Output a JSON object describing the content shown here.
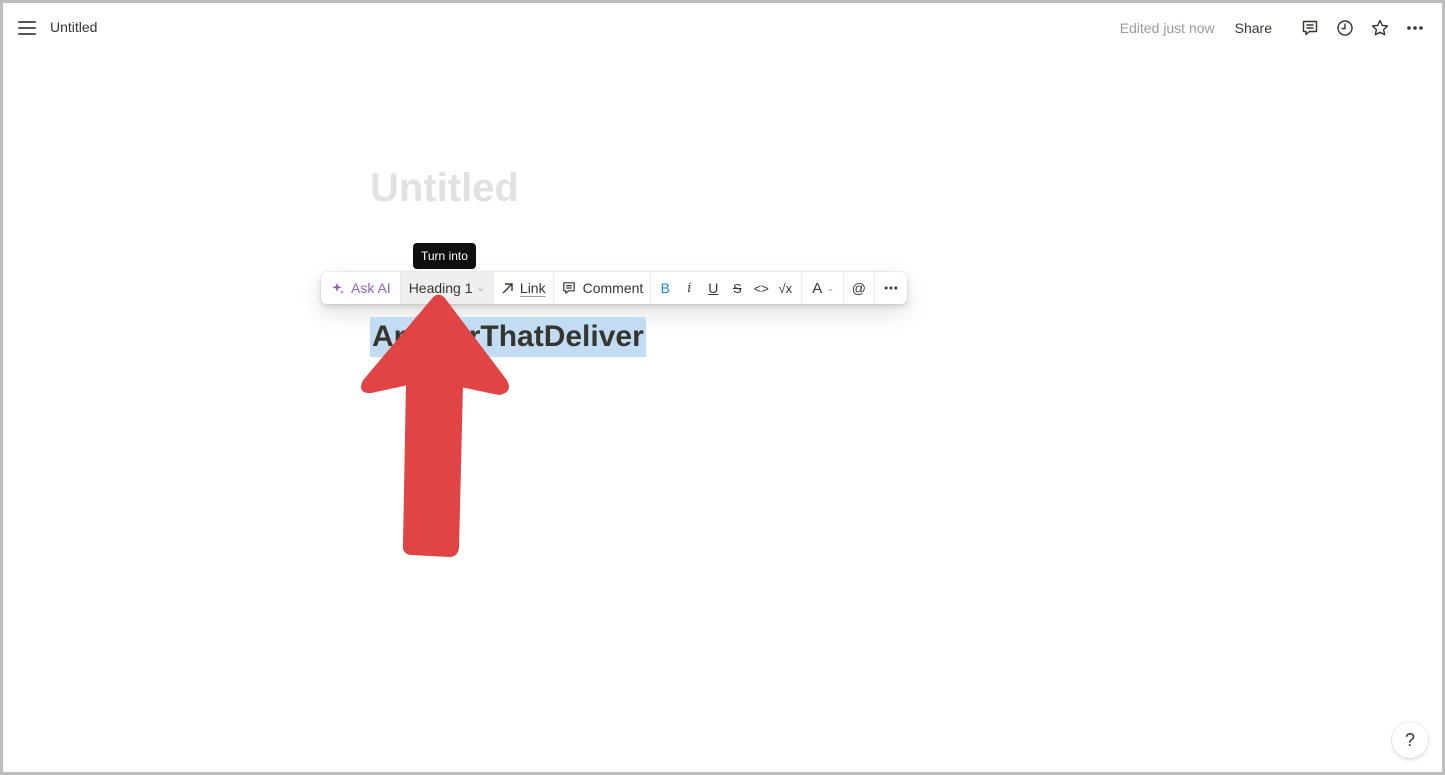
{
  "topbar": {
    "menu_icon": "hamburger-menu-icon",
    "page_name": "Untitled",
    "edited_status": "Edited just now",
    "share_label": "Share",
    "icons": [
      "comment-icon",
      "clock-history-icon",
      "star-icon",
      "more-horizontal-icon"
    ]
  },
  "page": {
    "title_placeholder": "Untitled",
    "heading_text": "AnswerThatDeliver"
  },
  "tooltip": {
    "text": "Turn into"
  },
  "toolbar": {
    "ask_ai": "Ask AI",
    "block_type": "Heading 1",
    "link": "Link",
    "comment": "Comment",
    "bold": "B",
    "italic": "i",
    "underline": "U",
    "strikethrough": "S",
    "code": "<>",
    "math": "√x",
    "text_color": "A",
    "mention": "@",
    "more": "•••"
  },
  "help": {
    "label": "?"
  },
  "colors": {
    "ai_purple": "#9065b0",
    "bold_blue": "#2383e2",
    "selection_blue": "#c2dcf4",
    "annotation_arrow": "#e04444"
  }
}
